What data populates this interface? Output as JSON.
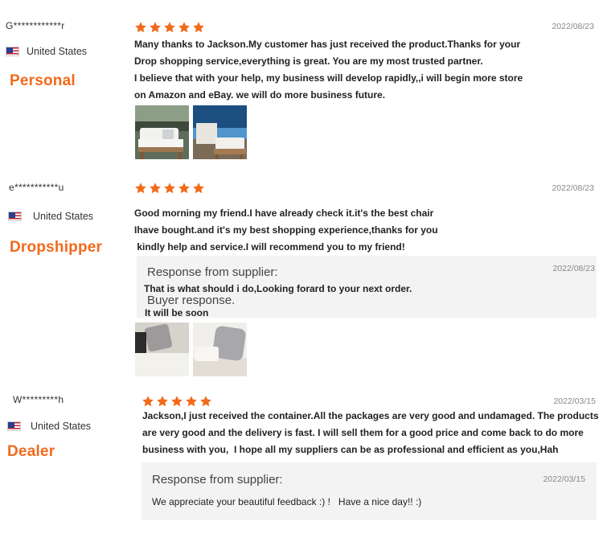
{
  "reviews": [
    {
      "user": "G************r",
      "country": "United States",
      "role": "Personal",
      "date": "2022/08/23",
      "lines": [
        "Many thanks to Jackson.My customer has just received the product.Thanks for your",
        "Drop shopping service,everything is great. You are my most trusted partner.",
        "I believe that with your help, my business will develop rapidly,,i will begin more store",
        "on Amazon and eBay. we will do more business future."
      ]
    },
    {
      "user": "e***********u",
      "country": "United States",
      "role": "Dropshipper",
      "date": "2022/08/23",
      "lines": [
        "Good morning my friend.I have already check it.it's the best chair",
        "Ihave bought.and it's my best shopping experience,thanks for you",
        " kindly help and service.I will recommend you to my friend!"
      ],
      "response": {
        "title": "Response from supplier:",
        "date": "2022/08/23",
        "text": "That is what should i do,Looking forard to your next order.",
        "buyer_title": "Buyer response.",
        "buyer_text": "It will be soon"
      }
    },
    {
      "user": "W*********h",
      "country": "United States",
      "role": "Dealer",
      "date": "2022/03/15",
      "lines": [
        "Jackson,I just received the container.All the packages are very good and undamaged. The products",
        "are very good and the delivery is fast. I will sell them for a good price and come back to do more",
        "business with you,  I hope all my suppliers can be as professional and efficient as you,Hah"
      ],
      "response": {
        "title": "Response from supplier:",
        "date": "2022/03/15",
        "text": "We appreciate your beautiful feedback :) !   Have a nice day!! :)"
      }
    }
  ],
  "colors": {
    "star": "#f26a1b",
    "role": "#f26a1b",
    "response_bg": "#f3f3f3"
  },
  "icons": [
    "flag-us-icon",
    "star-icon"
  ]
}
